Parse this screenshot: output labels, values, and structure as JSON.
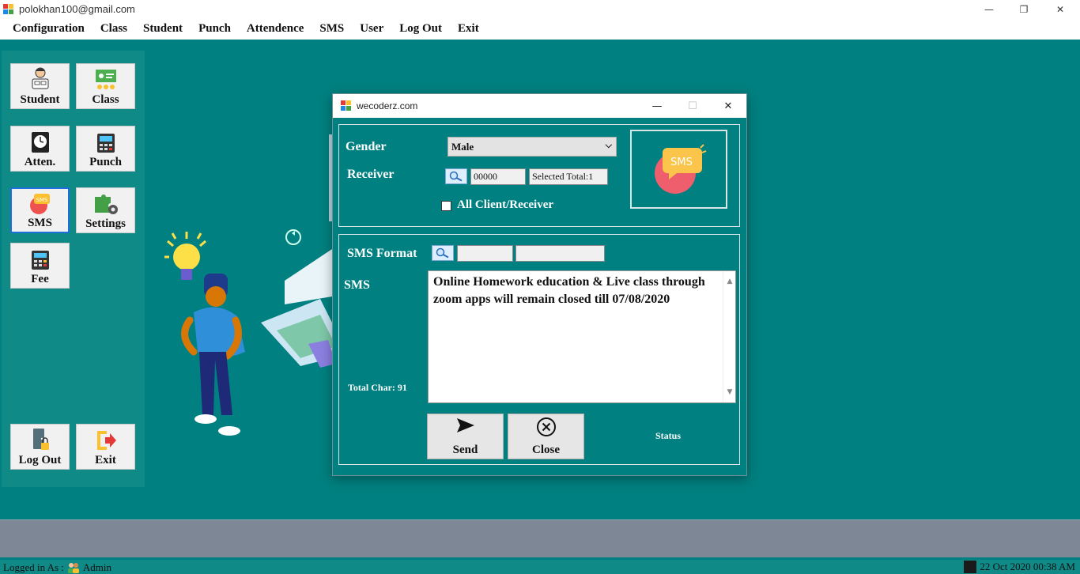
{
  "window": {
    "title": "polokhan100@gmail.com",
    "minimize": "—",
    "restore": "❐",
    "close": "✕"
  },
  "menu": [
    "Configuration",
    "Class",
    "Student",
    "Punch",
    "Attendence",
    "SMS",
    "User",
    "Log Out",
    "Exit"
  ],
  "sidebar": {
    "student": "Student",
    "class": "Class",
    "atten": "Atten.",
    "punch": "Punch",
    "sms": "SMS",
    "settings": "Settings",
    "fee": "Fee",
    "logout": "Log Out",
    "exit": "Exit"
  },
  "dialog": {
    "title": "wecoderz.com",
    "minimize": "—",
    "maximize": "☐",
    "close": "✕",
    "gender_label": "Gender",
    "gender_value": "Male",
    "receiver_label": "Receiver",
    "receiver_id": "00000",
    "selected_total": "Selected Total:1",
    "all_client_label": "All Client/Receiver",
    "sms_format_label": "SMS Format",
    "sms_format_code": "",
    "sms_format_name": "",
    "sms_label": "SMS",
    "sms_text": "Online Homework education & Live class through zoom apps will remain closed till 07/08/2020",
    "total_char": "Total Char: 91",
    "send_label": "Send",
    "close_label": "Close",
    "status_label": "Status",
    "sms_badge": "SMS"
  },
  "statusbar": {
    "logged_in": "Logged in As :",
    "user": "Admin",
    "datetime": "22 Oct 2020 00:38 AM"
  },
  "colors": {
    "background": "#008080",
    "accent": "#1e6fd9"
  }
}
